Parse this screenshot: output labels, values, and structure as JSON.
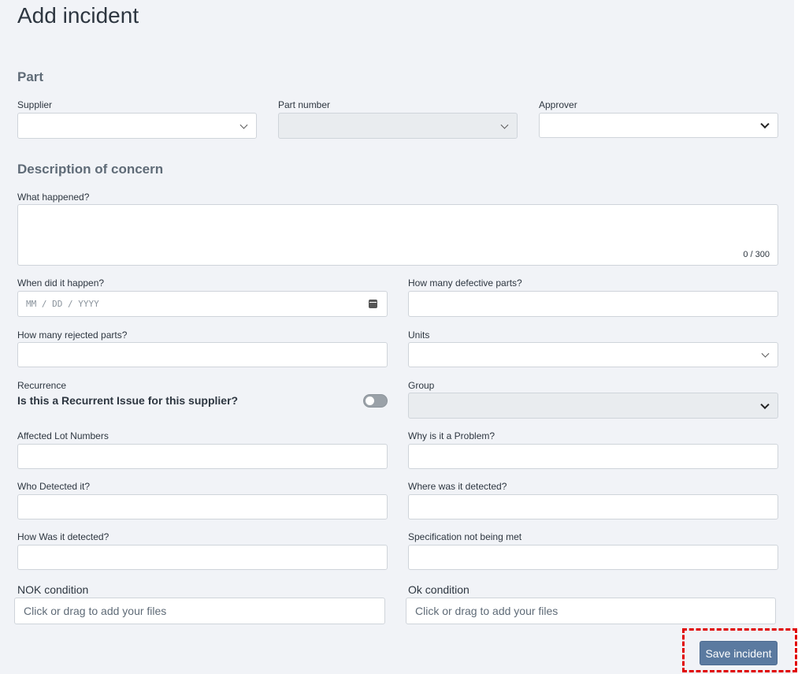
{
  "page": {
    "title": "Add incident"
  },
  "part": {
    "section_title": "Part",
    "supplier_label": "Supplier",
    "part_number_label": "Part number",
    "approver_label": "Approver"
  },
  "concern": {
    "section_title": "Description of concern",
    "what_happened_label": "What happened?",
    "what_happened_counter": "0 / 300",
    "when_label": "When did it happen?",
    "date_placeholder": "MM / DD / YYYY",
    "defective_label": "How many defective parts?",
    "rejected_label": "How many rejected parts?",
    "units_label": "Units",
    "recurrence_label": "Recurrence",
    "recurrence_question": "Is this a Recurrent Issue for this supplier?",
    "recurrence_value": false,
    "group_label": "Group",
    "lot_label": "Affected Lot Numbers",
    "why_label": "Why is it a Problem?",
    "who_label": "Who Detected it?",
    "where_label": "Where was it detected?",
    "how_label": "How Was it detected?",
    "spec_label": "Specification not being met",
    "nok_label": "NOK condition",
    "ok_label": "Ok condition",
    "file_placeholder": "Click or drag to add your files"
  },
  "actions": {
    "save_label": "Save incident"
  },
  "colors": {
    "accent": "#5b7aa0",
    "highlight": "#e00000",
    "background": "#f1f3f7"
  }
}
